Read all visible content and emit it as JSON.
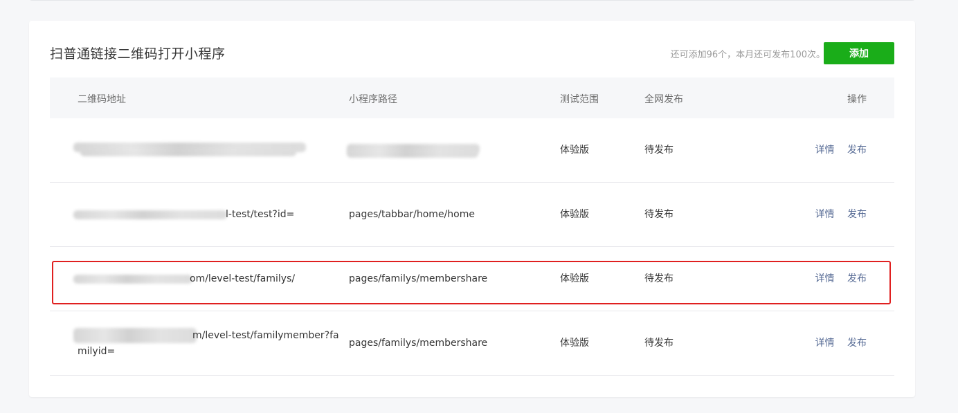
{
  "panel": {
    "title": "扫普通链接二维码打开小程序",
    "quota_tip": "还可添加96个，本月还可发布100次。",
    "add_label": "添加"
  },
  "table": {
    "headers": {
      "url": "二维码地址",
      "path": "小程序路径",
      "scope": "测试范围",
      "publish": "全网发布",
      "ops": "操作"
    },
    "rows": [
      {
        "url_visible": "",
        "path": "",
        "scope": "体验版",
        "publish": "待发布",
        "detail": "详情",
        "release": "发布"
      },
      {
        "url_visible": "l-test/test?id=",
        "path": "pages/tabbar/home/home",
        "scope": "体验版",
        "publish": "待发布",
        "detail": "详情",
        "release": "发布"
      },
      {
        "url_visible": "om/level-test/familys/",
        "path": "pages/familys/membershare",
        "scope": "体验版",
        "publish": "待发布",
        "detail": "详情",
        "release": "发布"
      },
      {
        "url_visible_line1": "m/level-test/familymember?fa",
        "url_visible_line2": "milyid=",
        "path": "pages/familys/membershare",
        "scope": "体验版",
        "publish": "待发布",
        "detail": "详情",
        "release": "发布"
      }
    ]
  },
  "colors": {
    "accent_green": "#1aad19",
    "link": "#576b95",
    "highlight": "#e02020"
  }
}
